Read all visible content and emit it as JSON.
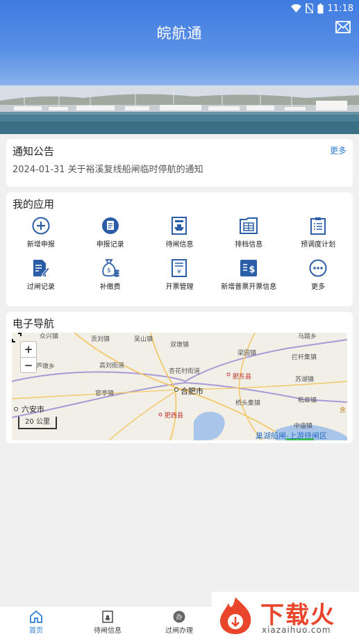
{
  "status_bar": {
    "time": "11:18"
  },
  "header": {
    "title": "皖航通",
    "mail_icon": "mail-icon"
  },
  "notice": {
    "title": "通知公告",
    "more": "更多",
    "item": "2024-01-31 关于裕溪复线船闸临时停航的通知"
  },
  "apps": {
    "title": "我的应用",
    "items": [
      {
        "label": "新增申报",
        "icon": "plus-circle-icon"
      },
      {
        "label": "申报记录",
        "icon": "record-icon"
      },
      {
        "label": "待闸信息",
        "icon": "ship-waiting-icon"
      },
      {
        "label": "排档信息",
        "icon": "table-icon"
      },
      {
        "label": "预调度计划",
        "icon": "clipboard-icon"
      },
      {
        "label": "过闸记录",
        "icon": "edit-doc-icon"
      },
      {
        "label": "补缴费",
        "icon": "money-bag-icon"
      },
      {
        "label": "开票管理",
        "icon": "invoice-icon"
      },
      {
        "label": "新增普票开票信息",
        "icon": "dollar-doc-icon"
      },
      {
        "label": "更多",
        "icon": "more-dots-icon"
      }
    ]
  },
  "navigation": {
    "title": "电子导航",
    "zoom_in": "+",
    "zoom_out": "−",
    "scale": "20 公里",
    "labels": {
      "zhongxing": "众兴镇",
      "dalang": "贡刘镇",
      "wushan": "吴山镇",
      "shuanggang": "双墩镇",
      "mati": "马踏乡",
      "gaoliu": "高刘街道",
      "liangyuan": "梁园镇",
      "langui": "拦杆集镇",
      "lujiao": "芦墩乡",
      "xinghua": "杏花村街道",
      "feidong": "肥东县",
      "guanting": "官亭镇",
      "hefei": "合肥市",
      "suhu": "苏湖镇",
      "qiaotou": "桥头集镇",
      "zhegao": "柘皋镇",
      "liuan": "六安市",
      "feixi": "肥西县",
      "zhongmiao": "中庙镇",
      "chaohu_lock": "巢湖船闸-上游待闸区",
      "he": "含"
    }
  },
  "tabbar": {
    "tabs": [
      {
        "label": "首页",
        "active": true
      },
      {
        "label": "待闸信息",
        "active": false
      },
      {
        "label": "过闸办理",
        "active": false
      }
    ]
  },
  "watermark": {
    "title": "下载火",
    "url": "xiazaihuo.com"
  }
}
